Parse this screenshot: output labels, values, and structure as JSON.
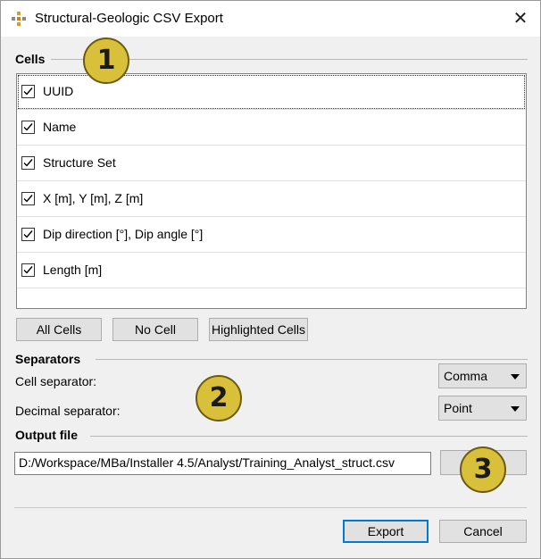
{
  "window": {
    "title": "Structural-Geologic CSV Export",
    "icon": "app-grid-icon",
    "close_icon": "close-icon",
    "close_glyph": "✕"
  },
  "cells": {
    "header": "Cells",
    "items": [
      {
        "label": "UUID",
        "checked": true
      },
      {
        "label": "Name",
        "checked": true
      },
      {
        "label": "Structure Set",
        "checked": true
      },
      {
        "label": "X [m], Y [m], Z [m]",
        "checked": true
      },
      {
        "label": "Dip direction [°], Dip angle [°]",
        "checked": true
      },
      {
        "label": "Length [m]",
        "checked": true
      }
    ],
    "buttons": {
      "all": "All Cells",
      "none": "No Cell",
      "highlighted": "Highlighted Cells"
    }
  },
  "separators": {
    "header": "Separators",
    "cell_label": "Cell separator:",
    "cell_value": "Comma",
    "decimal_label": "Decimal separator:",
    "decimal_value": "Point"
  },
  "output": {
    "header": "Output file",
    "path": "D:/Workspace/MBa/Installer 4.5/Analyst/Training_Analyst_struct.csv",
    "browse_label": ""
  },
  "footer": {
    "export_label": "Export",
    "cancel_label": "Cancel"
  },
  "callouts": [
    "1",
    "2",
    "3"
  ],
  "colors": {
    "accent": "#0078d7",
    "callout": "#d9c03a"
  }
}
